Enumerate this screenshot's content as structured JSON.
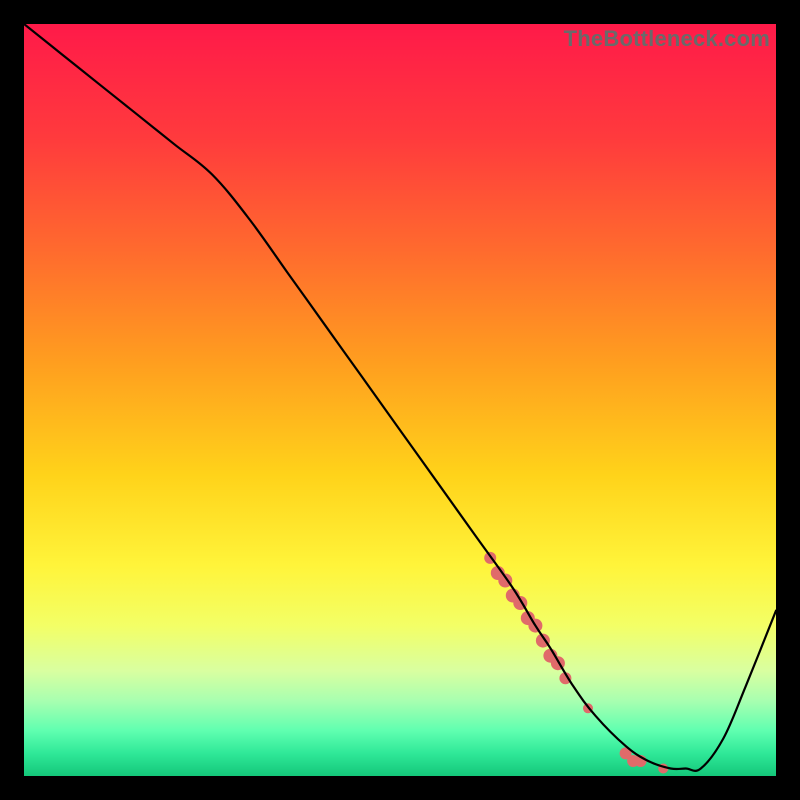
{
  "watermark": "TheBottleneck.com",
  "chart_data": {
    "type": "line",
    "title": "",
    "xlabel": "",
    "ylabel": "",
    "xlim": [
      0,
      100
    ],
    "ylim": [
      0,
      100
    ],
    "grid": false,
    "series": [
      {
        "name": "curve",
        "color_hex": "#000000",
        "x": [
          0,
          5,
          10,
          15,
          20,
          25,
          30,
          35,
          40,
          45,
          50,
          55,
          60,
          65,
          68,
          70,
          73,
          76,
          80,
          83,
          86,
          88,
          90,
          93,
          96,
          100
        ],
        "y": [
          100,
          96,
          92,
          88,
          84,
          80,
          74,
          67,
          60,
          53,
          46,
          39,
          32,
          25,
          20,
          17,
          12,
          8,
          4,
          2,
          1,
          1,
          1,
          5,
          12,
          22
        ]
      }
    ],
    "highlight_points": {
      "color_hex": "#e06a6a",
      "points": [
        {
          "x": 62,
          "y": 29,
          "r": 6
        },
        {
          "x": 63,
          "y": 27,
          "r": 7
        },
        {
          "x": 64,
          "y": 26,
          "r": 7
        },
        {
          "x": 65,
          "y": 24,
          "r": 7
        },
        {
          "x": 66,
          "y": 23,
          "r": 7
        },
        {
          "x": 67,
          "y": 21,
          "r": 7
        },
        {
          "x": 68,
          "y": 20,
          "r": 7
        },
        {
          "x": 69,
          "y": 18,
          "r": 7
        },
        {
          "x": 70,
          "y": 16,
          "r": 7
        },
        {
          "x": 71,
          "y": 15,
          "r": 7
        },
        {
          "x": 72,
          "y": 13,
          "r": 6
        },
        {
          "x": 75,
          "y": 9,
          "r": 5
        },
        {
          "x": 80,
          "y": 3,
          "r": 6
        },
        {
          "x": 81,
          "y": 2,
          "r": 6
        },
        {
          "x": 82,
          "y": 2,
          "r": 6
        },
        {
          "x": 85,
          "y": 1,
          "r": 5
        }
      ]
    },
    "background_gradient": {
      "stops": [
        {
          "offset": 0.0,
          "color": "#ff1a49"
        },
        {
          "offset": 0.15,
          "color": "#ff3a3d"
        },
        {
          "offset": 0.3,
          "color": "#ff6a2e"
        },
        {
          "offset": 0.45,
          "color": "#ff9e1f"
        },
        {
          "offset": 0.6,
          "color": "#ffd31a"
        },
        {
          "offset": 0.72,
          "color": "#fff43a"
        },
        {
          "offset": 0.8,
          "color": "#f3ff66"
        },
        {
          "offset": 0.86,
          "color": "#d9ffa0"
        },
        {
          "offset": 0.9,
          "color": "#a8ffb0"
        },
        {
          "offset": 0.94,
          "color": "#5fffb0"
        },
        {
          "offset": 0.97,
          "color": "#2fe898"
        },
        {
          "offset": 1.0,
          "color": "#14c77a"
        }
      ]
    }
  }
}
